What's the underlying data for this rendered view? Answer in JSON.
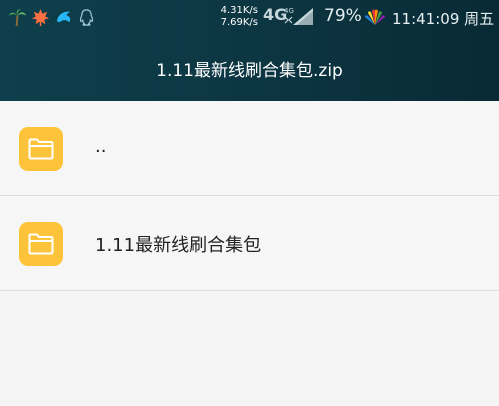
{
  "status_bar": {
    "net_speed_up": "4.31K/s",
    "net_speed_down": "7.69K/s",
    "network_type_primary": "4G",
    "network_type_secondary": "4G",
    "battery": "79%",
    "time": "11:41:09",
    "weekday": "周五",
    "icons": [
      "palm-tree-icon",
      "maple-leaf-icon",
      "dolphin-icon",
      "qq-icon",
      "signal-icon",
      "huawei-logo-icon"
    ]
  },
  "header": {
    "title": "1.11最新线刷合集包.zip"
  },
  "list": {
    "items": [
      {
        "label": "..",
        "icon": "folder-icon"
      },
      {
        "label": "1.11最新线刷合集包",
        "icon": "folder-icon"
      }
    ]
  },
  "colors": {
    "header_bg": "#0c3541",
    "folder_tile": "#fdc43b",
    "list_bg": "#f6f6f6",
    "divider": "#dedede"
  }
}
